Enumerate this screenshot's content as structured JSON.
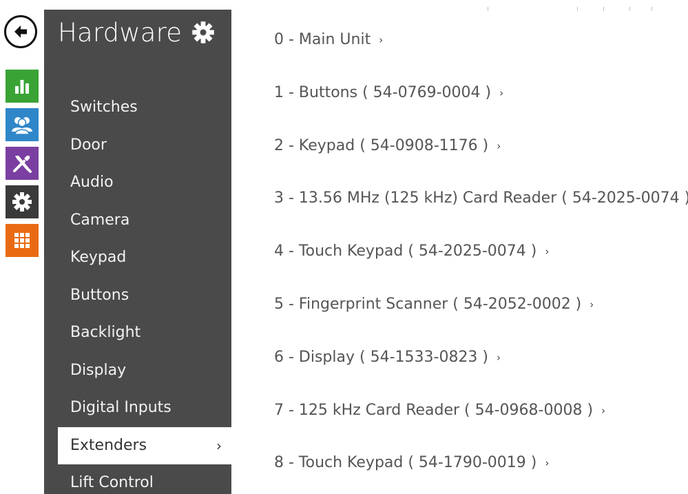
{
  "sidebar": {
    "title": "Hardware",
    "items": [
      {
        "label": "Switches"
      },
      {
        "label": "Door"
      },
      {
        "label": "Audio"
      },
      {
        "label": "Camera"
      },
      {
        "label": "Keypad"
      },
      {
        "label": "Buttons"
      },
      {
        "label": "Backlight"
      },
      {
        "label": "Display"
      },
      {
        "label": "Digital Inputs"
      },
      {
        "label": "Extenders",
        "active": true
      },
      {
        "label": "Lift Control"
      }
    ]
  },
  "rail": {
    "buttons": [
      {
        "icon": "back-arrow-icon"
      },
      {
        "icon": "bar-chart-icon",
        "color": "#3aa335"
      },
      {
        "icon": "users-icon",
        "color": "#2f87c9"
      },
      {
        "icon": "tools-icon",
        "color": "#7a3fa0"
      },
      {
        "icon": "gear-icon",
        "color": "#3a3a3a"
      },
      {
        "icon": "grid-icon",
        "color": "#ea6a13"
      }
    ]
  },
  "extenders": [
    {
      "label": "0 - Main Unit"
    },
    {
      "label": "1 - Buttons ( 54-0769-0004 )"
    },
    {
      "label": "2 - Keypad ( 54-0908-1176 )"
    },
    {
      "label": "3 - 13.56 MHz (125 kHz) Card Reader ( 54-2025-0074 )"
    },
    {
      "label": "4 - Touch Keypad ( 54-2025-0074 )"
    },
    {
      "label": "5 - Fingerprint Scanner ( 54-2052-0002 )"
    },
    {
      "label": "6 - Display ( 54-1533-0823 )"
    },
    {
      "label": "7 - 125 kHz Card Reader ( 54-0968-0008 )"
    },
    {
      "label": "8 - Touch Keypad ( 54-1790-0019 )"
    }
  ],
  "chevron": "›"
}
